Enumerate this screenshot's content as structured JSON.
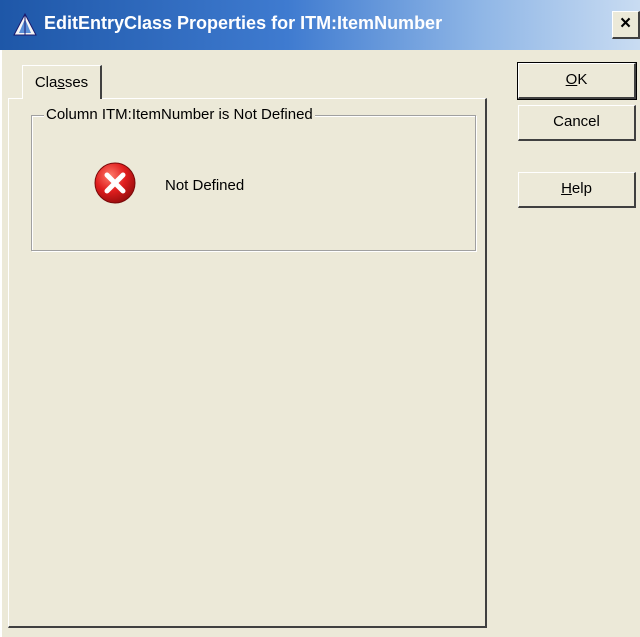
{
  "window": {
    "title": "EditEntryClass Properties for ITM:ItemNumber",
    "close_glyph": "×"
  },
  "tabs": [
    {
      "label_pre": "Cla",
      "label_accel": "s",
      "label_post": "ses"
    }
  ],
  "group": {
    "legend": "Column ITM:ItemNumber is Not Defined",
    "status_icon": "error-icon",
    "status_text": "Not Defined"
  },
  "buttons": {
    "ok": {
      "accel": "O",
      "rest": "K"
    },
    "cancel": {
      "label": "Cancel"
    },
    "help": {
      "accel": "H",
      "rest": "elp"
    }
  },
  "colors": {
    "title_bar_start": "#1e57a8",
    "title_bar_end": "#c9dcf2",
    "error_red": "#e01e1e",
    "window_bg": "#ece9d8"
  }
}
